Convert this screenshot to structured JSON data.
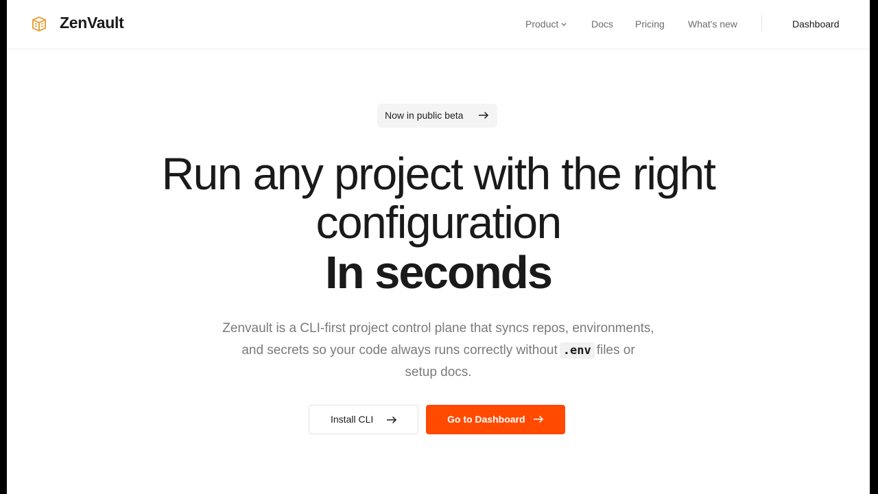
{
  "colors": {
    "accent": "#ff4a00",
    "logo": "#e8a23b",
    "text": "#1a1a1a",
    "muted": "#7a7a7a"
  },
  "header": {
    "brand": "ZenVault",
    "logo_icon": "package-box-icon",
    "nav": {
      "product": "Product",
      "docs": "Docs",
      "pricing": "Pricing",
      "whats_new": "What's new"
    },
    "dashboard": "Dashboard"
  },
  "hero": {
    "badge": "Now in public beta",
    "badge_icon": "arrow-right-icon",
    "title_line1": "Run any project with the right",
    "title_line2": "configuration",
    "title_line3": "In seconds",
    "subtitle_line1": "Zenvault is a CLI-first project control plane that syncs repos, environments,",
    "subtitle_line2_before": "and secrets so your code always runs correctly without",
    "subtitle_code": ".env",
    "subtitle_line2_after": "files or",
    "subtitle_line3": "setup docs."
  },
  "actions": {
    "install": "Install CLI",
    "go_dashboard": "Go to Dashboard"
  }
}
